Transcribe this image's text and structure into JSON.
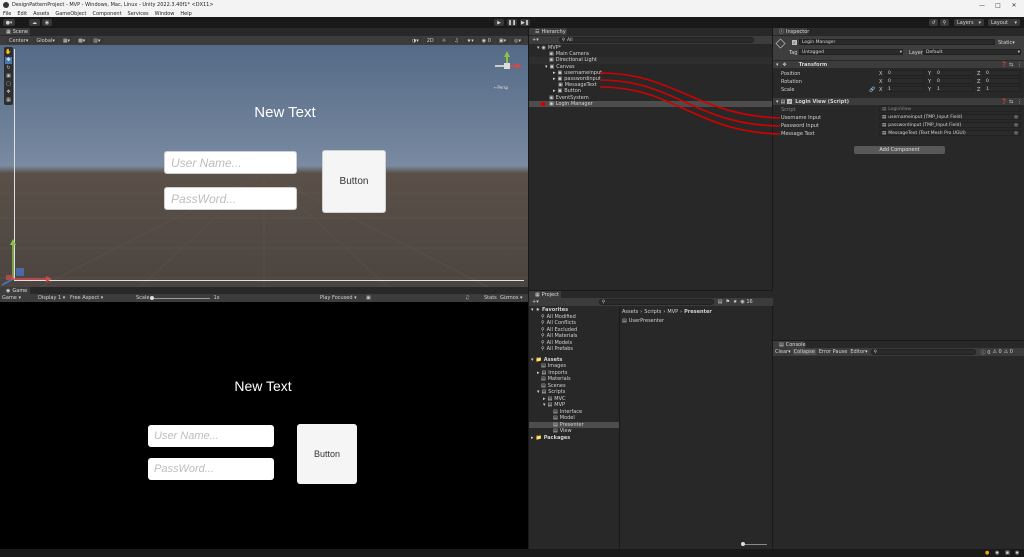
{
  "window": {
    "title": "DesignPatternProject - MVP - Windows, Mac, Linux - Unity 2022.3.40f1* <DX11>"
  },
  "menu": [
    "File",
    "Edit",
    "Assets",
    "GameObject",
    "Component",
    "Services",
    "Window",
    "Help"
  ],
  "toolbar": {
    "layers": "Layers",
    "layout": "Layout"
  },
  "scene": {
    "tab": "Scene",
    "center": "Center",
    "global": "Global",
    "view_mode": "2D",
    "persp": "←Persp",
    "new_text": "New Text",
    "username_placeholder": "User Name...",
    "password_placeholder": "PassWord...",
    "button": "Button"
  },
  "game": {
    "tab": "Game",
    "display_label": "Game",
    "display": "Display 1",
    "aspect": "Free Aspect",
    "scale_label": "Scale",
    "scale_value": "1x",
    "play_focused": "Play Focused",
    "stats": "Stats",
    "gizmos": "Gizmos",
    "new_text": "New Text",
    "username_placeholder": "User Name...",
    "password_placeholder": "PassWord...",
    "button": "Button"
  },
  "hierarchy": {
    "tab": "Hierarchy",
    "search": "All",
    "items": [
      {
        "name": "MVP*",
        "indent": 0
      },
      {
        "name": "Main Camera",
        "indent": 1
      },
      {
        "name": "Directional Light",
        "indent": 1
      },
      {
        "name": "Canvas",
        "indent": 1
      },
      {
        "name": "usernameinput",
        "indent": 2
      },
      {
        "name": "passwordinput",
        "indent": 2
      },
      {
        "name": "MessageText",
        "indent": 2
      },
      {
        "name": "Button",
        "indent": 2
      },
      {
        "name": "EventSystem",
        "indent": 1
      },
      {
        "name": "Login Manager",
        "indent": 1
      }
    ]
  },
  "inspector": {
    "tab": "Inspector",
    "object_name": "Login Manager",
    "static": "Static",
    "tag_label": "Tag",
    "tag": "Untagged",
    "layer_label": "Layer",
    "layer": "Default",
    "transform": {
      "title": "Transform",
      "position": "Position",
      "rotation": "Rotation",
      "scale": "Scale",
      "pos": [
        "0",
        "0",
        "0"
      ],
      "rot": [
        "0",
        "0",
        "0"
      ],
      "scl": [
        "1",
        "1",
        "1"
      ]
    },
    "script_component": {
      "title": "Login View (Script)",
      "script_label": "Script",
      "script_value": "LoginView",
      "username_label": "Username Input",
      "username_value": "usernameinput (TMP_Input Field)",
      "password_label": "Password Input",
      "password_value": "passwordinput (TMP_Input Field)",
      "message_label": "Message Text",
      "message_value": "MessageText (Text Mesh Pro UGUI)"
    },
    "add_component": "Add Component"
  },
  "project": {
    "tab": "Project",
    "breadcrumb": [
      "Assets",
      "Scripts",
      "MVP",
      "Presenter"
    ],
    "file": "UserPresenter",
    "favorites": {
      "title": "Favorites",
      "items": [
        "All Modified",
        "All Conflicts",
        "All Excluded",
        "All Materials",
        "All Models",
        "All Prefabs"
      ]
    },
    "assets": {
      "title": "Assets",
      "items": [
        {
          "name": "Images",
          "indent": 1
        },
        {
          "name": "Imports",
          "indent": 1
        },
        {
          "name": "Materials",
          "indent": 1
        },
        {
          "name": "Scenes",
          "indent": 1
        },
        {
          "name": "Scripts",
          "indent": 1
        },
        {
          "name": "MVC",
          "indent": 2
        },
        {
          "name": "MVP",
          "indent": 2
        },
        {
          "name": "Interface",
          "indent": 3
        },
        {
          "name": "Model",
          "indent": 3
        },
        {
          "name": "Presenter",
          "indent": 3
        },
        {
          "name": "View",
          "indent": 3
        }
      ]
    },
    "packages": "Packages"
  },
  "console": {
    "tab": "Console",
    "clear": "Clear",
    "collapse": "Collapse",
    "error_pause": "Error Pause",
    "editor": "Editor",
    "counts": [
      "0",
      "0",
      "0"
    ]
  },
  "colors": {
    "accent": "#2c5d87",
    "annotation": "#d40000"
  }
}
